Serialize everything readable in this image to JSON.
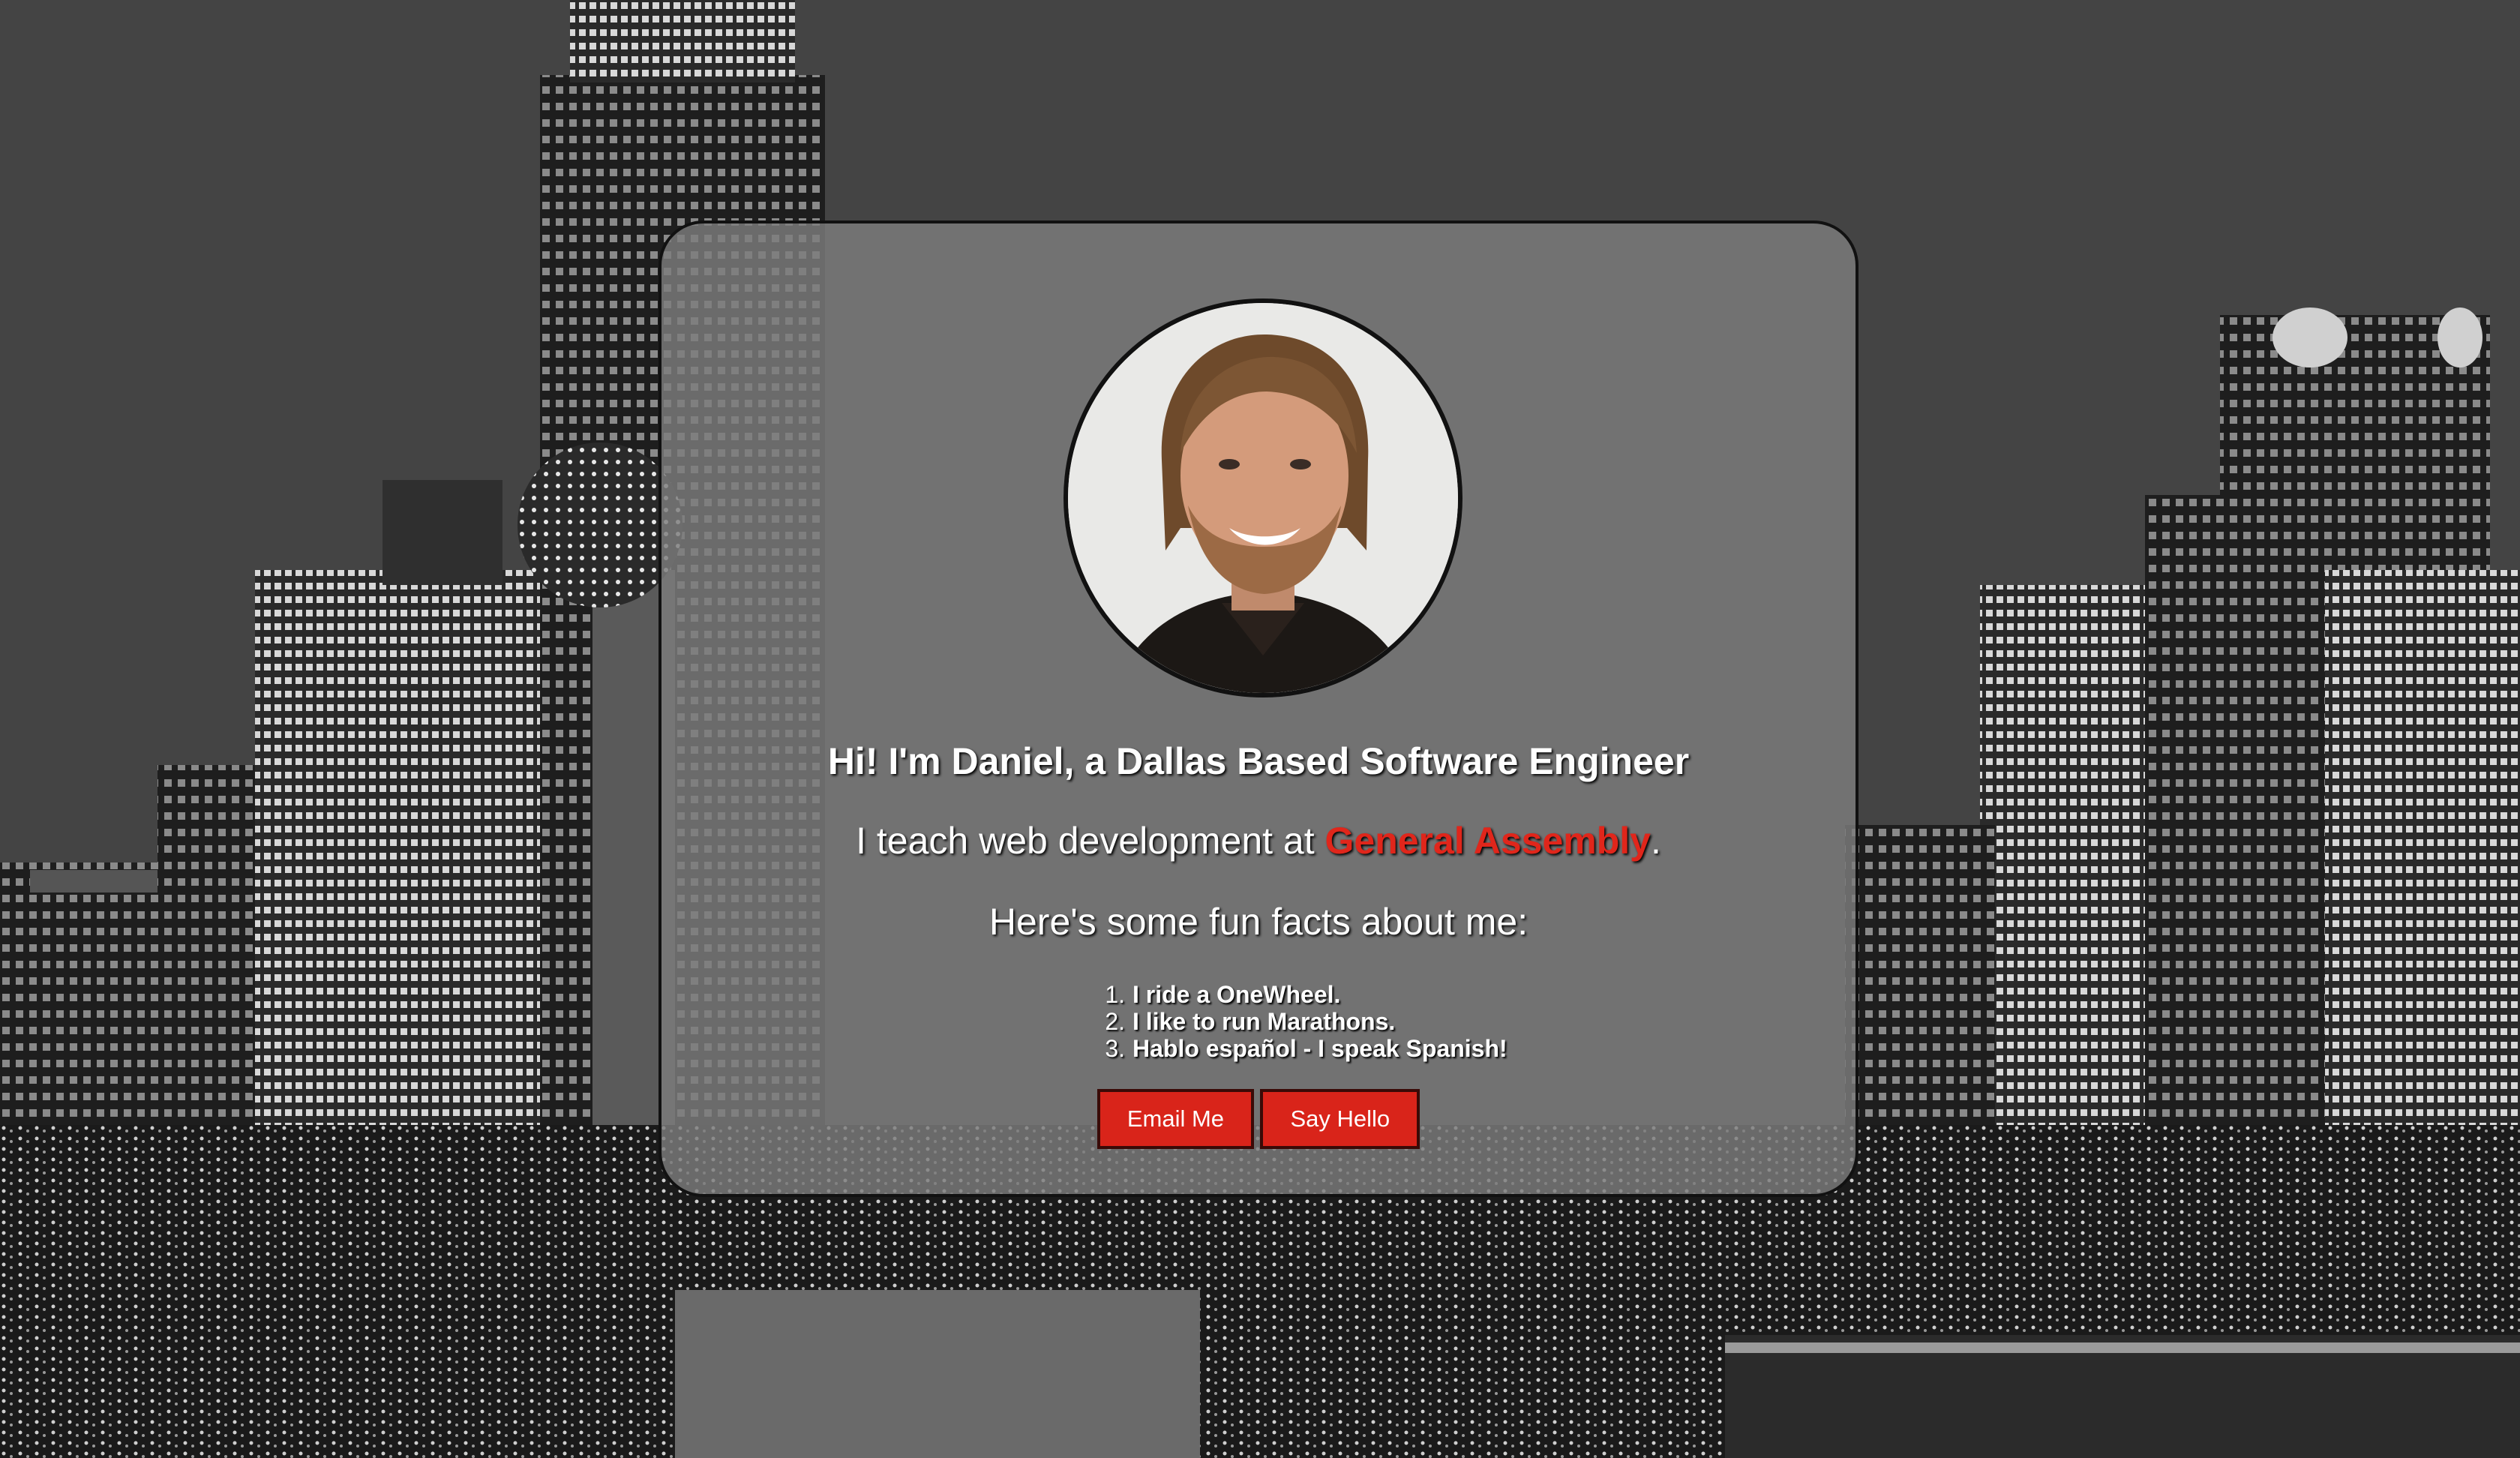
{
  "hero": {
    "headline": "Hi! I'm Daniel, a Dallas Based Software Engineer",
    "teach_prefix": "I teach web development at ",
    "teach_link": "General Assembly",
    "teach_suffix": ".",
    "facts_heading": "Here's some fun facts about me:",
    "facts": [
      {
        "num": "1.",
        "text": "I ride a OneWheel."
      },
      {
        "num": "2.",
        "text": "I like to run Marathons."
      },
      {
        "num": "3.",
        "text": "Hablo español - I speak Spanish!"
      }
    ],
    "buttons": {
      "email": "Email Me",
      "hello": "Say Hello"
    }
  },
  "colors": {
    "accent": "#d9241a",
    "link": "#e0261b",
    "card": "#7d7d7d"
  }
}
